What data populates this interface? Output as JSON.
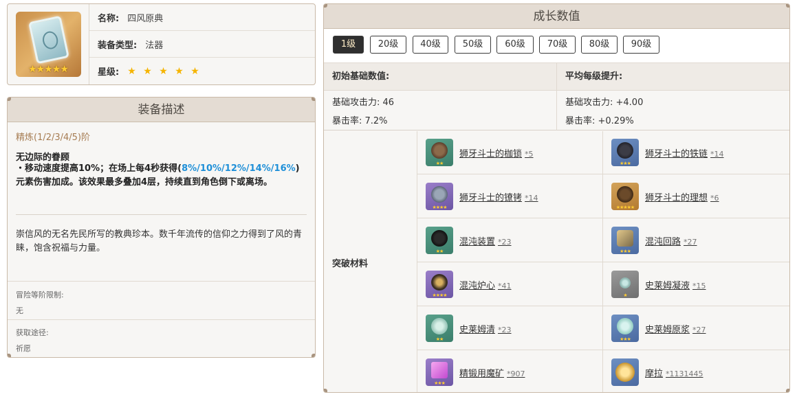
{
  "info": {
    "name_label": "名称:",
    "name_value": "四风原典",
    "type_label": "装备类型:",
    "type_value": "法器",
    "rarity_label": "星级:",
    "rarity_stars": "★ ★ ★ ★ ★",
    "icon_stars": "★★★★★",
    "icon_name": "book-catalyst-icon"
  },
  "description": {
    "header": "装备描述",
    "refine_title": "精炼(1/2/3/4/5)阶",
    "passive_name": "无边际的眷顾",
    "passive_text_1": "・移动速度提高10%；在场上每4秒获得(",
    "passive_highlight": "8%/10%/12%/14%/16%",
    "passive_text_2": ")",
    "passive_text_3": "元素伤害加成。该效果最多叠加4层，持续直到角色倒下或离场。",
    "lore": "崇信风的无名先民所写的教典珍本。数千年流传的信仰之力得到了风的青睐，饱含祝福与力量。",
    "ar_label": "冒险等阶限制:",
    "ar_value": "无",
    "source_label": "获取途径:",
    "source_value": "祈愿"
  },
  "growth": {
    "header": "成长数值",
    "levels": [
      "1级",
      "20级",
      "40级",
      "50级",
      "60级",
      "70级",
      "80级",
      "90级"
    ],
    "active_level": "1级",
    "base_title": "初始基础数值:",
    "per_level_title": "平均每级提升:",
    "base_atk": "基础攻击力: 46",
    "base_crit": "暴击率: 7.2%",
    "inc_atk": "基础攻击力: +4.00",
    "inc_crit": "暴击率: +0.29%",
    "materials_label": "突破材料",
    "materials": [
      {
        "name": "狮牙斗士的枷锁",
        "qty": "*5",
        "icon": "shackle-icon",
        "stars": "★★"
      },
      {
        "name": "狮牙斗士的铁链",
        "qty": "*14",
        "icon": "chain-icon",
        "stars": "★★★"
      },
      {
        "name": "狮牙斗士的镣铐",
        "qty": "*14",
        "icon": "fetters-icon",
        "stars": "★★★★"
      },
      {
        "name": "狮牙斗士的理想",
        "qty": "*6",
        "icon": "ideal-icon",
        "stars": "★★★★★"
      },
      {
        "name": "混沌装置",
        "qty": "*23",
        "icon": "chaos-device-icon",
        "stars": "★★"
      },
      {
        "name": "混沌回路",
        "qty": "*27",
        "icon": "chaos-circuit-icon",
        "stars": "★★★"
      },
      {
        "name": "混沌炉心",
        "qty": "*41",
        "icon": "chaos-core-icon",
        "stars": "★★★★"
      },
      {
        "name": "史莱姆凝液",
        "qty": "*15",
        "icon": "slime-condensate-icon",
        "stars": "★"
      },
      {
        "name": "史莱姆清",
        "qty": "*23",
        "icon": "slime-secretions-icon",
        "stars": "★★"
      },
      {
        "name": "史莱姆原浆",
        "qty": "*27",
        "icon": "slime-concentrate-icon",
        "stars": "★★★"
      },
      {
        "name": "精锻用魔矿",
        "qty": "*907",
        "icon": "mystic-ore-icon",
        "stars": "★★★"
      },
      {
        "name": "摩拉",
        "qty": "*1131445",
        "icon": "mora-icon",
        "stars": ""
      }
    ]
  },
  "colors": {
    "highlight": "#1e8fd8",
    "refine_title": "#a67c52",
    "header_bg": "#e4dcd3",
    "active_level_bg": "#2f2f2f",
    "star": "#f5b400"
  }
}
